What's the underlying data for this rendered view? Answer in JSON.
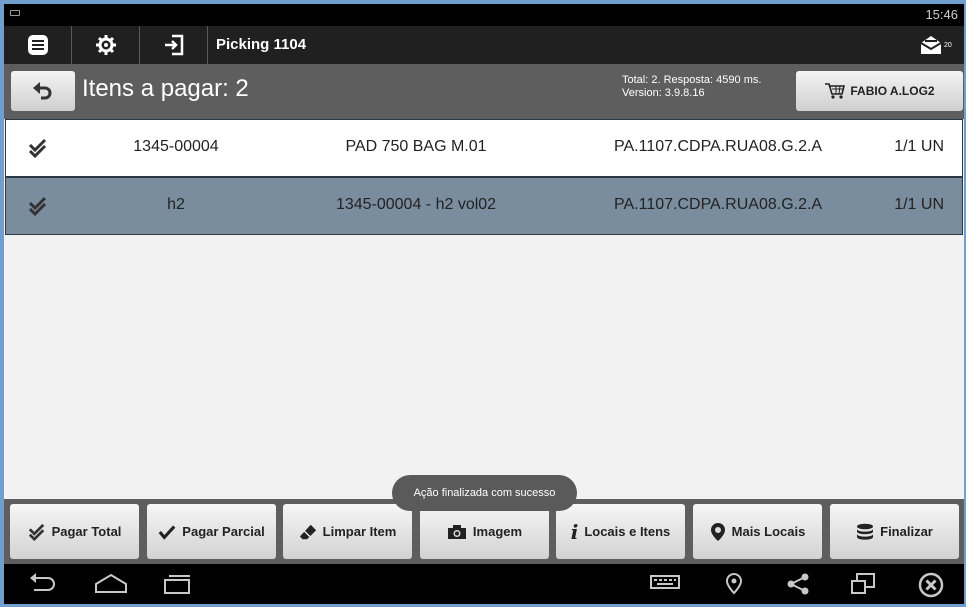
{
  "status_bar": {
    "time": "15:46",
    "keyboard_icon": "keyboard-icon"
  },
  "action_bar": {
    "icons": [
      "list-menu-icon",
      "settings-gear-icon",
      "sign-in-icon"
    ],
    "title": "Picking 1104",
    "mail_icon": "mail-icon",
    "mail_badge": "20"
  },
  "header": {
    "back_icon": "undo-icon",
    "title": "Itens a pagar: 2",
    "stats_line1": "Total: 2. Resposta: 4590 ms.",
    "stats_line2": "Version: 3.9.8.16",
    "user_icon": "cart-icon",
    "user_label": "FABIO A.LOG2"
  },
  "rows": [
    {
      "code": "1345-00004",
      "description": "PAD 750 BAG M.01",
      "location": "PA.1107.CDPA.RUA08.G.2.A",
      "qty": "1/1 UN",
      "selected": false
    },
    {
      "code": "h2",
      "description": "1345-00004 - h2 vol02",
      "location": "PA.1107.CDPA.RUA08.G.2.A",
      "qty": "1/1 UN",
      "selected": true
    }
  ],
  "toast": "Ação finalizada com sucesso",
  "buttons": {
    "pagar_total": "Pagar Total",
    "pagar_parcial": "Pagar Parcial",
    "limpar_item": "Limpar Item",
    "imagem": "Imagem",
    "locais_itens": "Locais e Itens",
    "mais_locais": "Mais Locais",
    "finalizar": "Finalizar"
  },
  "navbar_icons": [
    "back-icon",
    "home-icon",
    "recent-apps-icon",
    "keyboard-icon",
    "location-pin-icon",
    "share-icon",
    "window-icon",
    "close-circle-icon"
  ],
  "colors": {
    "header": "#5e5e5e",
    "selected_row": "#7a8d9f",
    "actionbar": "#202020"
  }
}
